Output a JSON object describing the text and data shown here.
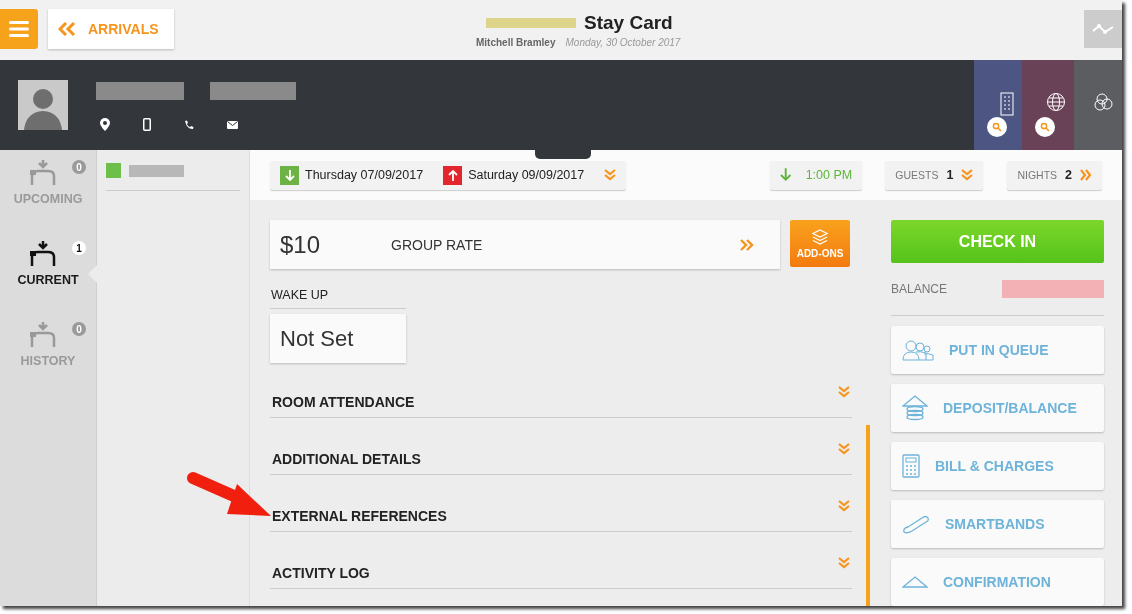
{
  "top_bar": {
    "back_button": "ARRIVALS",
    "title": "Stay Card",
    "user": "Mitchell Bramley",
    "date": "Monday, 30 October 2017"
  },
  "nav": [
    {
      "label": "UPCOMING",
      "count": "0",
      "selected": false
    },
    {
      "label": "CURRENT",
      "count": "1",
      "selected": true
    },
    {
      "label": "HISTORY",
      "count": "0",
      "selected": false
    }
  ],
  "stay": {
    "arrival": "Thursday 07/09/2017",
    "departure": "Saturday 09/09/2017",
    "time": "1:00 PM",
    "guests_label": "GUESTS",
    "guests": "1",
    "nights_label": "NIGHTS",
    "nights": "2"
  },
  "rate": {
    "amount": "$10",
    "name": "GROUP RATE",
    "addons": "ADD-ONS"
  },
  "wake_up": {
    "label": "WAKE UP",
    "value": "Not Set"
  },
  "sections": [
    {
      "title": "ROOM ATTENDANCE"
    },
    {
      "title": "ADDITIONAL DETAILS"
    },
    {
      "title": "EXTERNAL REFERENCES"
    },
    {
      "title": "ACTIVITY LOG"
    }
  ],
  "actions": {
    "check_in": "CHECK IN",
    "balance_label": "BALANCE",
    "buttons": [
      {
        "label": "PUT IN QUEUE",
        "kind": "queue"
      },
      {
        "label": "DEPOSIT/BALANCE",
        "kind": "deposit"
      },
      {
        "label": "BILL & CHARGES",
        "kind": "bill"
      },
      {
        "label": "SMARTBANDS",
        "kind": "band"
      },
      {
        "label": "CONFIRMATION",
        "kind": "confirm"
      }
    ]
  }
}
